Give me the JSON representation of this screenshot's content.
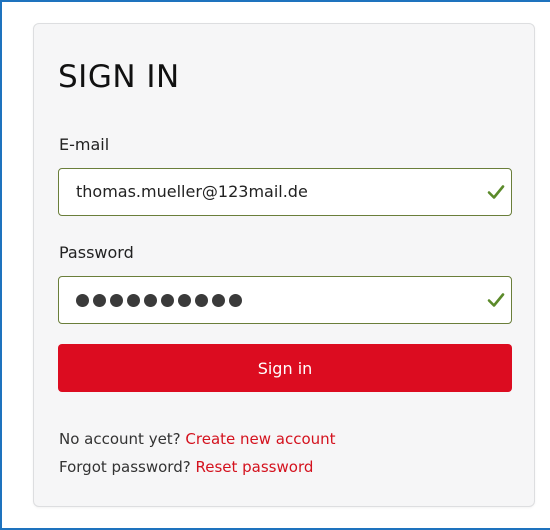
{
  "form": {
    "title": "SIGN IN",
    "email": {
      "label": "E-mail",
      "value": "thomas.mueller@123mail.de",
      "valid_icon": "check-icon"
    },
    "password": {
      "label": "Password",
      "masked_value": "●●●●●●●●●●",
      "length": 10,
      "valid_icon": "check-icon"
    },
    "submit_label": "Sign in",
    "no_account_text": "No account yet?",
    "create_account_link": "Create new account",
    "forgot_text": "Forgot password?",
    "reset_link": "Reset password"
  },
  "colors": {
    "accent_red": "#dc0c20",
    "link_red": "#d4121e",
    "valid_green": "#5b8a2a",
    "field_border": "#6a7e3a",
    "frame_blue": "#1e73be",
    "card_bg": "#f6f6f7"
  }
}
